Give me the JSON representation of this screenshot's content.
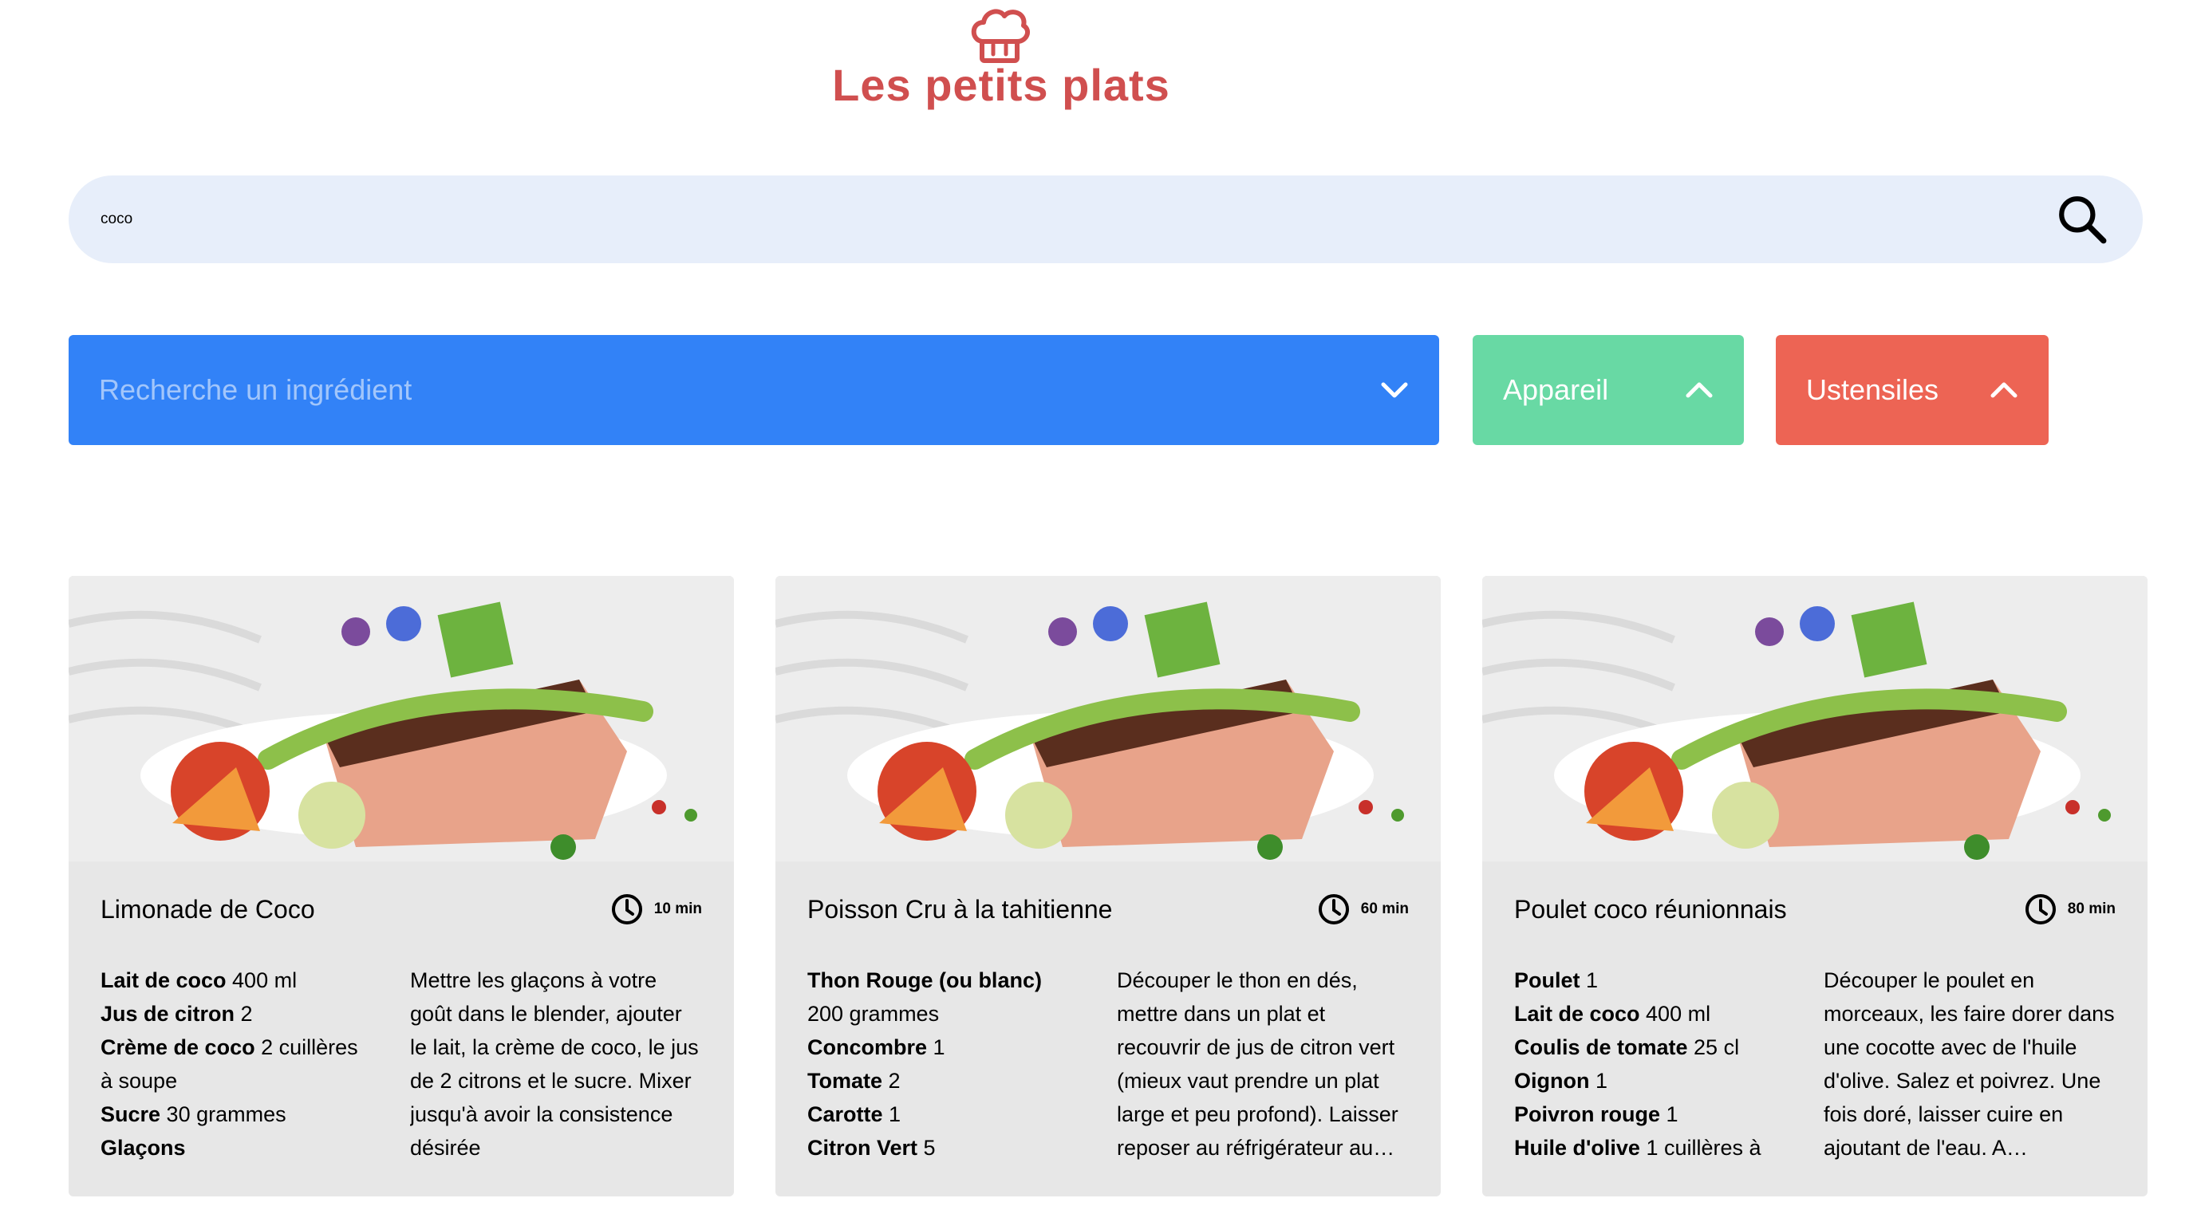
{
  "header": {
    "title": "Les petits plats",
    "logo_icon": "chef-hat-icon",
    "brand_color": "#D04F4F"
  },
  "search": {
    "value": "coco",
    "icon": "search-icon"
  },
  "filters": [
    {
      "label": "Recherche un ingrédient",
      "color": "#3282F7",
      "icon": "chevron-down-icon"
    },
    {
      "label": "Appareil",
      "color": "#68D9A4",
      "icon": "chevron-up-icon"
    },
    {
      "label": "Ustensiles",
      "color": "#ED6454",
      "icon": "chevron-up-icon"
    }
  ],
  "recipes": [
    {
      "name": "Limonade de Coco",
      "time": "10 min",
      "ingredients": [
        {
          "name": "Lait de coco",
          "qty": " 400 ml"
        },
        {
          "name": "Jus de citron",
          "qty": " 2"
        },
        {
          "name": "Crème de coco",
          "qty": " 2 cuillères à soupe"
        },
        {
          "name": "Sucre",
          "qty": " 30 grammes"
        },
        {
          "name": "Glaçons",
          "qty": ""
        }
      ],
      "description": "Mettre les glaçons à votre goût dans le blender, ajouter le lait, la crème de coco, le jus de 2 citrons et le sucre. Mixer jusqu'à avoir la consistence désirée"
    },
    {
      "name": "Poisson Cru à la tahitienne",
      "time": "60 min",
      "ingredients": [
        {
          "name": "Thon Rouge (ou blanc)",
          "qty": " 200 grammes"
        },
        {
          "name": "Concombre",
          "qty": " 1"
        },
        {
          "name": "Tomate",
          "qty": " 2"
        },
        {
          "name": "Carotte",
          "qty": " 1"
        },
        {
          "name": "Citron Vert",
          "qty": " 5"
        }
      ],
      "description": "Découper le thon en dés, mettre dans un plat et recouvrir de jus de citron vert (mieux vaut prendre un plat large et peu profond). Laisser reposer au réfrigérateur au…"
    },
    {
      "name": "Poulet coco réunionnais",
      "time": "80 min",
      "ingredients": [
        {
          "name": "Poulet",
          "qty": " 1"
        },
        {
          "name": "Lait de coco",
          "qty": " 400 ml"
        },
        {
          "name": "Coulis de tomate",
          "qty": " 25 cl"
        },
        {
          "name": "Oignon",
          "qty": " 1"
        },
        {
          "name": "Poivron rouge",
          "qty": " 1"
        },
        {
          "name": "Huile d'olive",
          "qty": " 1 cuillères à"
        }
      ],
      "description": "Découper le poulet en morceaux, les faire dorer dans une cocotte avec de l'huile d'olive. Salez et poivrez. Une fois doré, laisser cuire en ajoutant de l'eau. A…"
    }
  ]
}
